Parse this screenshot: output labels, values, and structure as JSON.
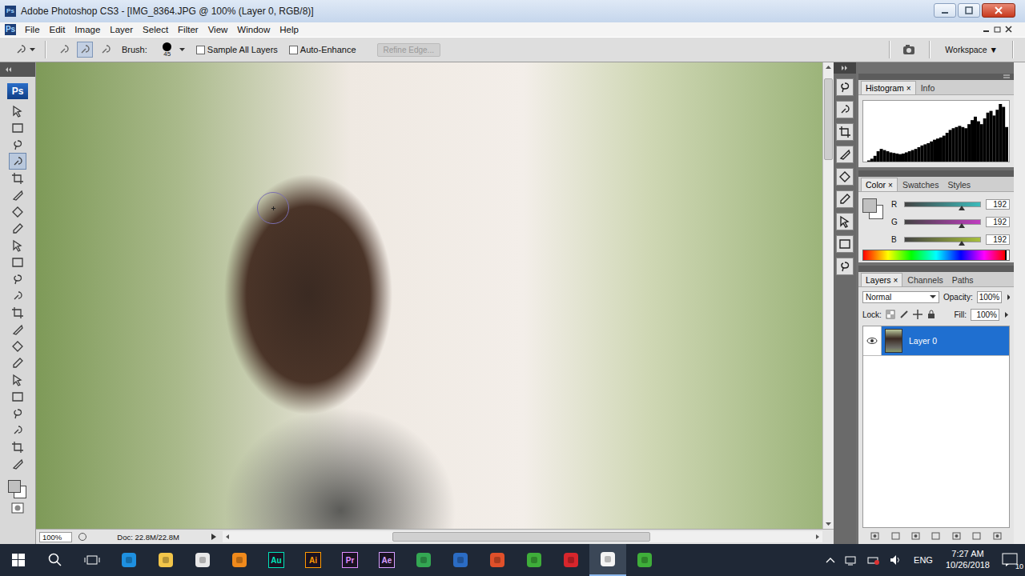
{
  "window": {
    "title": "Adobe Photoshop CS3 - [IMG_8364.JPG @ 100% (Layer 0, RGB/8)]",
    "app_icon": "Ps"
  },
  "menu": [
    {
      "label": "File"
    },
    {
      "label": "Edit"
    },
    {
      "label": "Image"
    },
    {
      "label": "Layer"
    },
    {
      "label": "Select"
    },
    {
      "label": "Filter"
    },
    {
      "label": "View"
    },
    {
      "label": "Window"
    },
    {
      "label": "Help"
    }
  ],
  "options_bar": {
    "modes": [
      {
        "selected": false
      },
      {
        "selected": true
      },
      {
        "selected": false
      }
    ],
    "brush_label": "Brush:",
    "brush_size": "45",
    "checkboxes": [
      {
        "label": "Sample All Layers",
        "checked": false
      },
      {
        "label": "Auto-Enhance",
        "checked": false
      }
    ],
    "refine_edge": {
      "label": "Refine Edge...",
      "disabled": true
    },
    "workspace": "Workspace",
    "workspace_arrow": "▼"
  },
  "toolbox": {
    "logo": "Ps",
    "tools": [
      {
        "selected": false
      },
      {
        "selected": false
      },
      {
        "selected": false
      },
      {
        "selected": true
      },
      {
        "selected": false
      },
      {
        "selected": false
      },
      {
        "selected": false
      },
      {
        "selected": false
      },
      {
        "selected": false
      },
      {
        "selected": false
      },
      {
        "selected": false
      },
      {
        "selected": false
      },
      {
        "selected": false
      },
      {
        "selected": false
      },
      {
        "selected": false
      },
      {
        "selected": false
      },
      {
        "selected": false
      },
      {
        "selected": false
      },
      {
        "selected": false
      },
      {
        "selected": false
      },
      {
        "selected": false
      },
      {
        "selected": false
      }
    ]
  },
  "canvas": {
    "zoom": "100%",
    "doc": "Doc: 22.8M/22.8M"
  },
  "histogram_panel": {
    "close_glyph": "×",
    "tabs": [
      {
        "label": "Histogram",
        "selected": true
      },
      {
        "label": "Info",
        "selected": false
      }
    ],
    "values": [
      0,
      2,
      5,
      10,
      18,
      22,
      20,
      18,
      16,
      15,
      14,
      13,
      14,
      16,
      18,
      20,
      22,
      25,
      28,
      30,
      32,
      35,
      38,
      40,
      42,
      45,
      50,
      55,
      58,
      60,
      62,
      60,
      58,
      65,
      72,
      78,
      70,
      65,
      75,
      85,
      88,
      80,
      90,
      100,
      95,
      60
    ]
  },
  "color_panel": {
    "close_glyph": "×",
    "tabs": [
      {
        "label": "Color",
        "selected": true
      },
      {
        "label": "Swatches",
        "selected": false
      },
      {
        "label": "Styles",
        "selected": false
      }
    ],
    "channels": [
      {
        "name": "R",
        "value": "192",
        "level": 0.753,
        "color": "#3cbcbc"
      },
      {
        "name": "G",
        "value": "192",
        "level": 0.753,
        "color": "#c03cc0"
      },
      {
        "name": "B",
        "value": "192",
        "level": 0.753,
        "color": "#a8c03c"
      }
    ]
  },
  "layers_panel": {
    "close_glyph": "×",
    "tabs": [
      {
        "label": "Layers",
        "selected": true
      },
      {
        "label": "Channels",
        "selected": false
      },
      {
        "label": "Paths",
        "selected": false
      }
    ],
    "blend_mode": "Normal",
    "opacity_label": "Opacity:",
    "opacity": "100%",
    "lock_label": "Lock:",
    "fill_label": "Fill:",
    "fill": "100%",
    "layers": [
      {
        "name": "Layer 0",
        "selected": true,
        "visible": true
      }
    ]
  },
  "taskbar": {
    "apps": [
      {
        "kind": "icon",
        "label": "",
        "color": "#1e90e0",
        "active": false
      },
      {
        "kind": "icon",
        "label": "",
        "color": "#f3c64a",
        "active": false
      },
      {
        "kind": "icon",
        "label": "",
        "color": "#e8e8e8",
        "active": false
      },
      {
        "kind": "icon",
        "label": "",
        "color": "#f08a1c",
        "active": false
      },
      {
        "kind": "letters",
        "label": "Au",
        "color": "#00e4bb",
        "active": false
      },
      {
        "kind": "letters",
        "label": "Ai",
        "color": "#ff9a00",
        "active": false
      },
      {
        "kind": "letters",
        "label": "Pr",
        "color": "#e08cff",
        "active": false
      },
      {
        "kind": "letters",
        "label": "Ae",
        "color": "#d6a0ff",
        "active": false
      },
      {
        "kind": "icon",
        "label": "",
        "color": "#34a853",
        "active": false
      },
      {
        "kind": "icon",
        "label": "",
        "color": "#2b6cc4",
        "active": false
      },
      {
        "kind": "icon",
        "label": "",
        "color": "#e0502a",
        "active": false
      },
      {
        "kind": "icon",
        "label": "",
        "color": "#3fae3a",
        "active": false
      },
      {
        "kind": "icon",
        "label": "",
        "color": "#d8262c",
        "active": false
      },
      {
        "kind": "icon",
        "label": "",
        "color": "#f4f4f4",
        "active": true
      },
      {
        "kind": "icon",
        "label": "",
        "color": "#3fae3a",
        "active": false
      }
    ],
    "language": "ENG",
    "time": "7:27 AM",
    "date": "10/26/2018",
    "notifications": "10"
  }
}
